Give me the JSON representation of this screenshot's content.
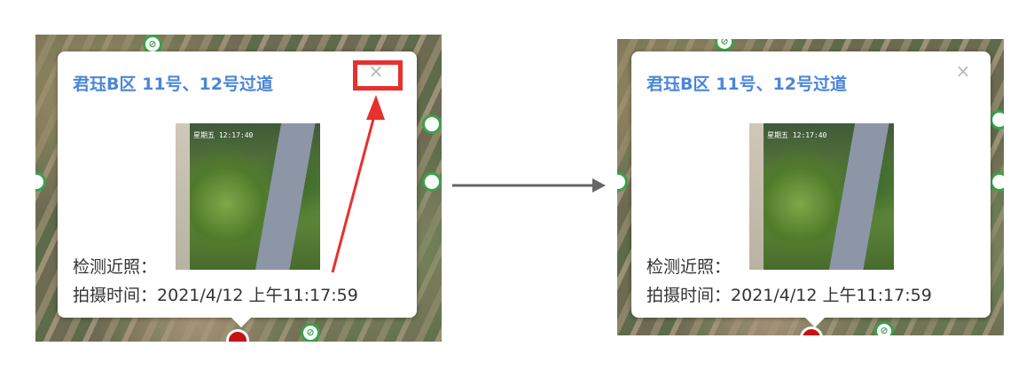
{
  "popup": {
    "title": "君珏B区 11号、12号过道",
    "close_symbol": "×",
    "photo_label": "检测近照：",
    "time_label": "拍摄时间：",
    "time_value": "2021/4/12 上午11:17:59",
    "photo_overlay": "星期五 12:17:40"
  },
  "colors": {
    "title": "#4a86d8",
    "highlight": "#e8302e",
    "flow_arrow": "#666666"
  },
  "icons": {
    "close": "close-icon",
    "map_marker": "map-marker-icon",
    "selected_marker": "selected-marker-icon",
    "flow_arrow": "right-arrow-icon",
    "callout_arrow": "callout-arrow-icon"
  }
}
